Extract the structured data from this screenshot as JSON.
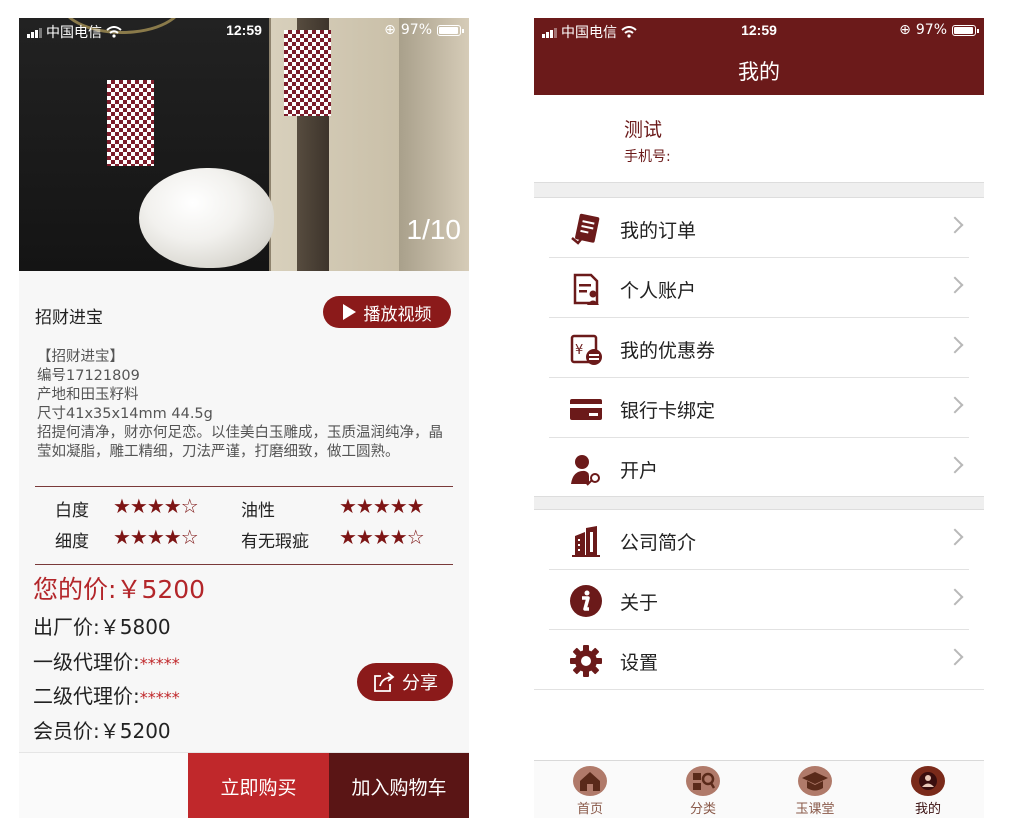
{
  "status_bar": {
    "carrier": "中国电信",
    "time": "12:59",
    "battery": "97%",
    "battery_level": 0.97
  },
  "product_screen": {
    "image_counter": "1/10",
    "product_name": "招财进宝",
    "play_video_label": "播放视频",
    "description": [
      "【招财进宝】",
      "编号17121809",
      "产地和田玉籽料",
      "尺寸41x35x14mm 44.5g",
      "招提何清净，财亦何足恋。以佳美白玉雕成，玉质温润纯净，晶莹如凝脂，雕工精细，刀法严谨，打磨细致，做工圆熟。"
    ],
    "ratings": [
      {
        "label": "白度",
        "stars": "★★★★☆",
        "score": 4
      },
      {
        "label": "油性",
        "stars": "★★★★★",
        "score": 5
      },
      {
        "label": "细度",
        "stars": "★★★★☆",
        "score": 4
      },
      {
        "label": "有无瑕疵",
        "stars": "★★★★☆",
        "score": 4
      }
    ],
    "your_price_label": "您的价:",
    "your_price_value": "￥5200",
    "factory_price_label": "出厂价:",
    "factory_price_value": "￥5800",
    "agent1_label": "一级代理价:",
    "agent1_value": "*****",
    "agent2_label": "二级代理价:",
    "agent2_value": "*****",
    "member_price_label": "会员价:",
    "member_price_value": "￥5200",
    "share_label": "分享",
    "buy_now_label": "立即购买",
    "add_cart_label": "加入购物车"
  },
  "profile_screen": {
    "nav_title": "我的",
    "user_name": "测试",
    "phone_label": "手机号:",
    "menu_group1": [
      {
        "label": "我的订单",
        "icon": "order-icon"
      },
      {
        "label": "个人账户",
        "icon": "account-icon"
      },
      {
        "label": "我的优惠券",
        "icon": "coupon-icon"
      },
      {
        "label": "银行卡绑定",
        "icon": "bank-card-icon"
      },
      {
        "label": "开户",
        "icon": "open-account-icon"
      }
    ],
    "menu_group2": [
      {
        "label": "公司简介",
        "icon": "company-icon"
      },
      {
        "label": "关于",
        "icon": "info-icon"
      },
      {
        "label": "设置",
        "icon": "gear-icon"
      }
    ],
    "tabs": [
      {
        "label": "首页",
        "icon": "home-icon"
      },
      {
        "label": "分类",
        "icon": "category-icon"
      },
      {
        "label": "玉课堂",
        "icon": "classroom-icon"
      },
      {
        "label": "我的",
        "icon": "profile-icon",
        "active": true
      }
    ]
  },
  "colors": {
    "brand_dark_red": "#6b1a1a",
    "button_red": "#8b1a1a",
    "price_red": "#b3262a",
    "buy_now_red": "#c0282b",
    "add_cart_maroon": "#5a1515"
  }
}
